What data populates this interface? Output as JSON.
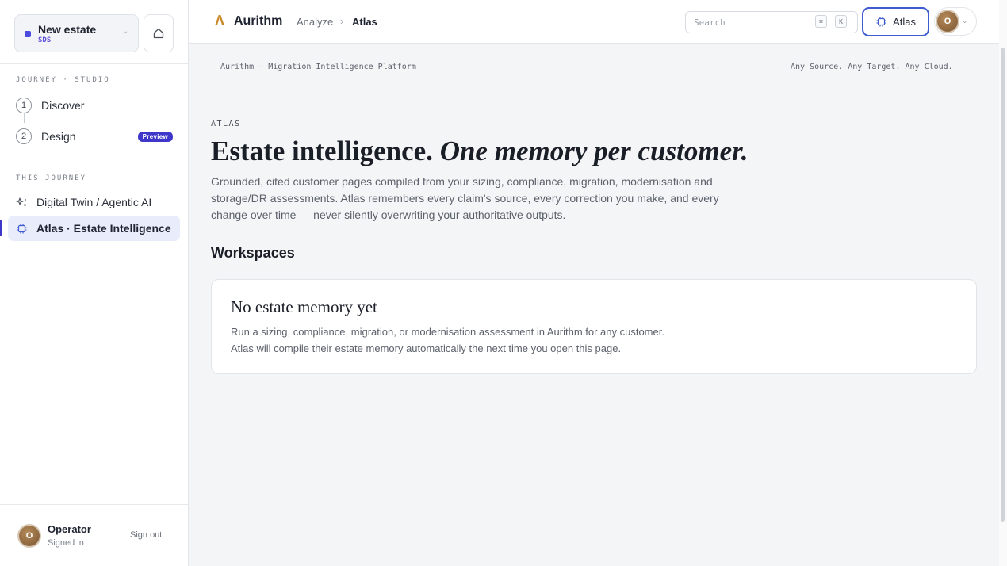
{
  "sidebar": {
    "estate": {
      "name": "New estate",
      "sub": "SDS",
      "chevron": "⌄"
    },
    "journey_section": "JOURNEY · STUDIO",
    "steps": [
      {
        "num": "1",
        "label": "Discover"
      },
      {
        "num": "2",
        "label": "Design",
        "badge": "Preview"
      }
    ],
    "this_journey_section": "THIS JOURNEY",
    "items": [
      {
        "label": "Digital Twin / Agentic AI",
        "icon": "sparkle-icon"
      },
      {
        "label": "Atlas · Estate Intelligence",
        "icon": "chip-icon",
        "active": true
      }
    ],
    "user": {
      "initial": "O",
      "name": "Operator",
      "status": "Signed in",
      "signout": "Sign out"
    }
  },
  "topbar": {
    "brand_mark": "Λ",
    "brand": "Aurithm",
    "breadcrumb": [
      "Analyze",
      "Atlas"
    ],
    "breadcrumb_sep": "›",
    "search_placeholder": "Search",
    "kbd": [
      "⌘",
      "K"
    ],
    "atlas_button": "Atlas",
    "account_initial": "O",
    "account_chevron": "⌄"
  },
  "main": {
    "tagline_left": "Aurithm — Migration Intelligence Platform",
    "tagline_right": "Any Source. Any Target. Any Cloud.",
    "eyebrow": "ATLAS",
    "hero_plain": "Estate intelligence. ",
    "hero_italic": "One memory per customer.",
    "description": "Grounded, cited customer pages compiled from your sizing, compliance, migration, modernisation and storage/DR assessments. Atlas remembers every claim's source, every correction you make, and every change over time — never silently overwriting your authoritative outputs.",
    "workspaces_title": "Workspaces",
    "empty_title": "No estate memory yet",
    "empty_line1": "Run a sizing, compliance, migration, or modernisation assessment in Aurithm for any customer.",
    "empty_line2": "Atlas will compile their estate memory automatically the next time you open this page."
  },
  "colors": {
    "accent": "#3f37c9",
    "brand_mark": "#c98a2a",
    "active_bg": "#e9edfb"
  }
}
